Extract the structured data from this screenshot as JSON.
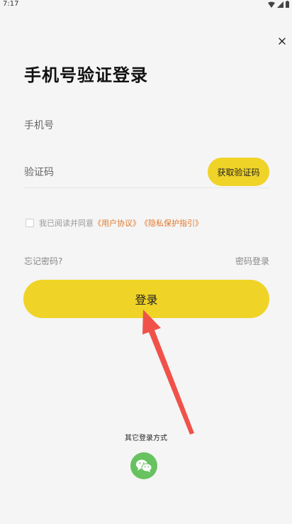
{
  "status_bar": {
    "time": "7:17"
  },
  "page": {
    "title": "手机号验证登录"
  },
  "phone": {
    "placeholder": "手机号"
  },
  "code": {
    "placeholder": "验证码",
    "button_label": "获取验证码"
  },
  "agreement": {
    "prefix": "我已阅读并同意",
    "user_agreement": "《用户协议》",
    "privacy_policy": "《隐私保护指引》",
    "checked": false
  },
  "links": {
    "forgot_password": "忘记密码?",
    "password_login": "密码登录"
  },
  "login_button": {
    "label": "登录"
  },
  "other_login": {
    "label": "其它登录方式",
    "icon": "wechat-icon"
  },
  "colors": {
    "accent": "#f0d327",
    "link": "#e2782c",
    "wechat": "#67c25f",
    "arrow": "#f0524a"
  }
}
